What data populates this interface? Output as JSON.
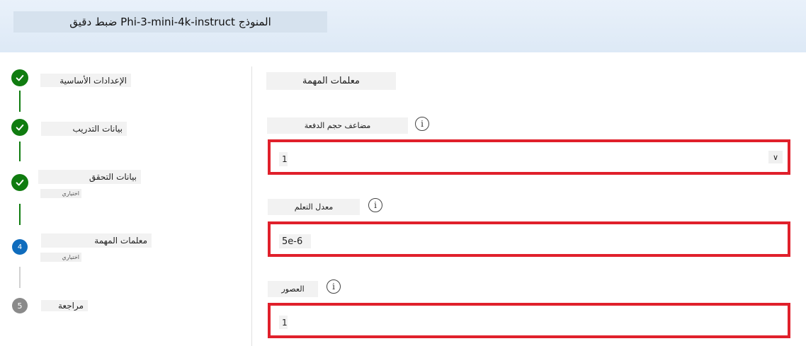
{
  "header": {
    "title": "ضبط دقيق Phi-3-mini-4k-instruct المنوذج"
  },
  "steps": [
    {
      "label": "الإعدادات الأساسية",
      "status": "done"
    },
    {
      "label": "بيانات التدريب",
      "status": "done"
    },
    {
      "label": "بيانات التحقق",
      "sub": "اختياري",
      "status": "done"
    },
    {
      "label": "معلمات المهمة",
      "sub": "اختياري",
      "status": "active",
      "number": "4"
    },
    {
      "label": "مراجعة",
      "status": "pending",
      "number": "5"
    }
  ],
  "main": {
    "section_title": "معلمات المهمة",
    "fields": [
      {
        "label": "مضاعف حجم الدفعة",
        "value": "1",
        "type": "select"
      },
      {
        "label": "معدل التعلم",
        "value": "5e-6",
        "type": "input"
      },
      {
        "label": "العصور",
        "value": "1",
        "type": "input"
      }
    ]
  },
  "icons": {
    "check": "checkmark-icon",
    "info": "info-icon",
    "chevron": "chevron-down-icon"
  },
  "colors": {
    "done": "#107c10",
    "active": "#0f6cbd",
    "pending": "#8a8a8a",
    "highlight": "#e0202b"
  }
}
